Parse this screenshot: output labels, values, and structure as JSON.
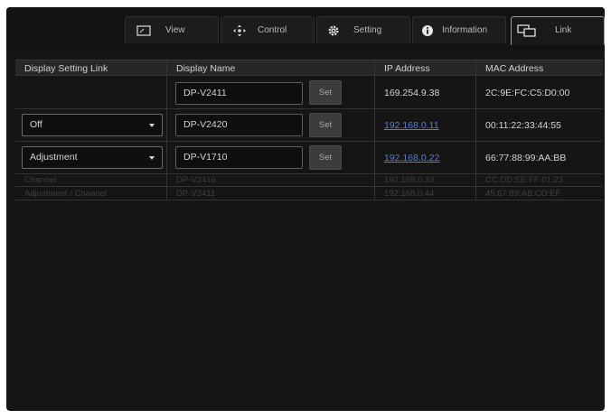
{
  "tabs": [
    {
      "label": "View",
      "icon": "view-icon",
      "active": false
    },
    {
      "label": "Control",
      "icon": "move-icon",
      "active": false
    },
    {
      "label": "Setting",
      "icon": "gear-icon",
      "active": false
    },
    {
      "label": "Information",
      "icon": "info-icon",
      "active": false
    },
    {
      "label": "Link",
      "icon": "link-displays-icon",
      "active": true
    }
  ],
  "table": {
    "headers": [
      "Display Setting Link",
      "Display Name",
      "IP Address",
      "MAC Address"
    ],
    "rows": [
      {
        "link": "",
        "name": "DP-V2411",
        "set": "Set",
        "ip": "169.254.9.38",
        "ip_link": false,
        "mac": "2C:9E:FC:C5:D0:00"
      },
      {
        "link": "Off",
        "name": "DP-V2420",
        "set": "Set",
        "ip": "192.168.0.11",
        "ip_link": true,
        "mac": "00:11:22:33:44:55"
      },
      {
        "link": "Adjustment",
        "name": "DP-V1710",
        "set": "Set",
        "ip": "192.168.0.22",
        "ip_link": true,
        "mac": "66:77:88:99:AA:BB"
      },
      {
        "link": "Channel",
        "name": "DP-V2416",
        "ip": "192.168.0.33",
        "mac": "CC:DD:EE:FF:01:23"
      },
      {
        "link": "Adjustment / Channel",
        "name": "DP-V2411",
        "ip": "192.168.0.44",
        "mac": "45:67:89:AB:CD:EF"
      }
    ]
  },
  "colors": {
    "background": "#151516",
    "header": "#272729",
    "link": "#5b7bd8",
    "active_tab_border": "#9a9a9c"
  }
}
